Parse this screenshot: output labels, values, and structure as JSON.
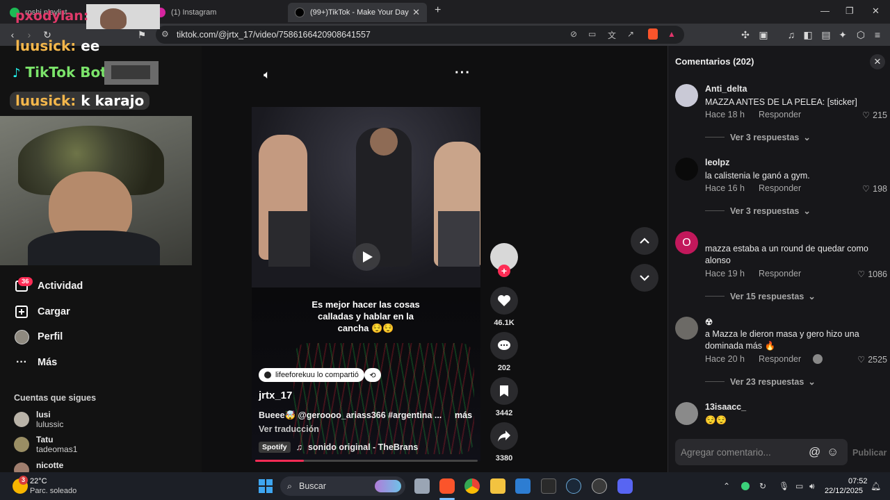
{
  "browser": {
    "tabs": [
      {
        "label": "roshi playlist",
        "active": false
      },
      {
        "label": "(1) Instagram",
        "active": false
      },
      {
        "label": "(99+)TikTok - Make Your Day",
        "active": true
      }
    ],
    "url": "tiktok.com/@jrtx_17/video/7586166420908641557"
  },
  "overlay": {
    "top_name": "pxodylan:",
    "chat": [
      {
        "name": "luusick:",
        "msg": "ee"
      },
      {
        "name": "TikTok BotRix:",
        "msg": ""
      },
      {
        "name": "luusick:",
        "msg": "k karajo"
      }
    ]
  },
  "sidebar": {
    "items": [
      {
        "label": "Actividad",
        "badge": "36",
        "icon": "inbox-icon"
      },
      {
        "label": "Cargar",
        "icon": "plus-square-icon"
      },
      {
        "label": "Perfil",
        "icon": "avatar-icon"
      },
      {
        "label": "Más",
        "icon": "ellipsis-icon"
      }
    ],
    "following_title": "Cuentas que sigues",
    "following": [
      {
        "name": "lusi",
        "handle": "lulussic"
      },
      {
        "name": "Tatu",
        "handle": "tadeomas1"
      },
      {
        "name": "nicotte",
        "handle": ""
      }
    ]
  },
  "video": {
    "caption": "Es mejor hacer las cosas calladas y hablar en la cancha 😌😌",
    "shared_by": "lifeeforekuu lo compartió",
    "author": "jrtx_17",
    "description": "Bueee🤯 @geroooo_ariass366 #argentina ...",
    "more": "más",
    "translate": "Ver traducción",
    "music_badge": "Spotify",
    "music": "sonido original - TheBrans",
    "progress": 0.22,
    "likes": "46.1K",
    "comments": "202",
    "saves": "3442",
    "shares": "3380"
  },
  "comments_panel": {
    "title": "Comentarios (202)",
    "input_placeholder": "Agregar comentario...",
    "publish": "Publicar",
    "reply_label": "Responder",
    "items": [
      {
        "user": "Anti_delta",
        "text": "MAZZA ANTES DE LA PELEA: [sticker]",
        "time": "Hace 18 h",
        "likes": "215",
        "replies": "Ver 3 respuestas",
        "avatar_color": "#c9c9d6"
      },
      {
        "user": "leolpz",
        "text": "la calistenia le ganó a gym.",
        "time": "Hace 16 h",
        "likes": "198",
        "replies": "Ver 3 respuestas",
        "avatar_color": "#0a0a0a"
      },
      {
        "user": "O",
        "text": "mazza estaba a un round de quedar como alonso",
        "time": "Hace 19 h",
        "likes": "1086",
        "replies": "Ver 15 respuestas",
        "avatar_color": "#c2185b"
      },
      {
        "user": "☢",
        "text": "a Mazza le dieron masa y gero hizo una dominada más 🔥",
        "time": "Hace 20 h",
        "likes": "2525",
        "replies": "Ver 23 respuestas",
        "avatar_color": "#6c6a66"
      },
      {
        "user": "13isaacc_",
        "text": "😌😌",
        "time": "",
        "likes": "",
        "replies": "",
        "avatar_color": "#8a8a8a"
      }
    ]
  },
  "taskbar": {
    "weather_temp": "22°C",
    "weather_desc": "Parc. soleado",
    "weather_badge": "3",
    "search": "Buscar",
    "time": "07:52",
    "date": "22/12/2025"
  },
  "colors": {
    "accent": "#fe2c55",
    "overlay_name": "#f3b64b"
  }
}
